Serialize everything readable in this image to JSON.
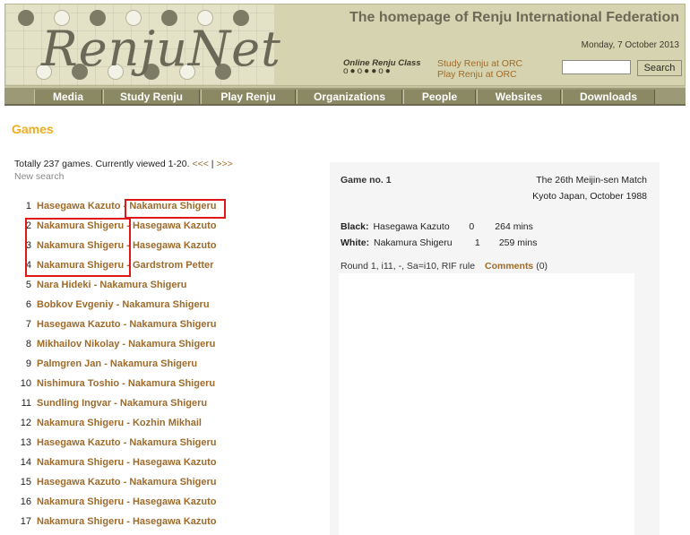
{
  "header": {
    "logo_text": "RenjuNet",
    "site_title": "The homepage of Renju International Federation",
    "date": "Monday, 7 October 2013",
    "orc_logo_line1": "Online Renju Class",
    "orc_logo_line2": "o●o●●o●",
    "orc_link_study": "Study Renju at ORC",
    "orc_link_play": "Play Renju at ORC",
    "search_button": "Search",
    "search_value": ""
  },
  "nav": [
    "Media",
    "Study Renju",
    "Play Renju",
    "Organizations",
    "People",
    "Websites",
    "Downloads"
  ],
  "page_title": "Games",
  "summary": {
    "text": "Totally 237 games. Currently viewed 1-20.",
    "prev": "<<<",
    "sep": "|",
    "next": ">>>",
    "new_search": "New search"
  },
  "games": [
    {
      "num": "1",
      "black": "Hasegawa Kazuto",
      "white": "Nakamura Shigeru"
    },
    {
      "num": "2",
      "black": "Nakamura Shigeru",
      "white": "Hasegawa Kazuto"
    },
    {
      "num": "3",
      "black": "Nakamura Shigeru",
      "white": "Hasegawa Kazuto"
    },
    {
      "num": "4",
      "black": "Nakamura Shigeru",
      "white": "Gardstrom Petter"
    },
    {
      "num": "5",
      "black": "Nara Hideki",
      "white": "Nakamura Shigeru"
    },
    {
      "num": "6",
      "black": "Bobkov Evgeniy",
      "white": "Nakamura Shigeru"
    },
    {
      "num": "7",
      "black": "Hasegawa Kazuto",
      "white": "Nakamura Shigeru"
    },
    {
      "num": "8",
      "black": "Mikhailov Nikolay",
      "white": "Nakamura Shigeru"
    },
    {
      "num": "9",
      "black": "Palmgren Jan",
      "white": "Nakamura Shigeru"
    },
    {
      "num": "10",
      "black": "Nishimura Toshio",
      "white": "Nakamura Shigeru"
    },
    {
      "num": "11",
      "black": "Sundling Ingvar",
      "white": "Nakamura Shigeru"
    },
    {
      "num": "12",
      "black": "Nakamura Shigeru",
      "white": "Kozhin Mikhail"
    },
    {
      "num": "13",
      "black": "Hasegawa Kazuto",
      "white": "Nakamura Shigeru"
    },
    {
      "num": "14",
      "black": "Nakamura Shigeru",
      "white": "Hasegawa Kazuto"
    },
    {
      "num": "15",
      "black": "Hasegawa Kazuto",
      "white": "Nakamura Shigeru"
    },
    {
      "num": "16",
      "black": "Nakamura Shigeru",
      "white": "Hasegawa Kazuto"
    },
    {
      "num": "17",
      "black": "Nakamura Shigeru",
      "white": "Hasegawa Kazuto"
    }
  ],
  "detail": {
    "game_label": "Game no. 1",
    "event": "The 26th Meijin-sen Match",
    "place": "Kyoto Japan, October 1988",
    "black_label": "Black:",
    "black_name": "Hasegawa Kazuto",
    "black_score": "0",
    "black_time": "264 mins",
    "white_label": "White:",
    "white_name": "Nakamura Shigeru",
    "white_score": "1",
    "white_time": "259 mins",
    "extra": "Round 1, i11, -, Sa=i10, RIF rule",
    "comments_label": "Comments",
    "comments_count": "(0)"
  }
}
